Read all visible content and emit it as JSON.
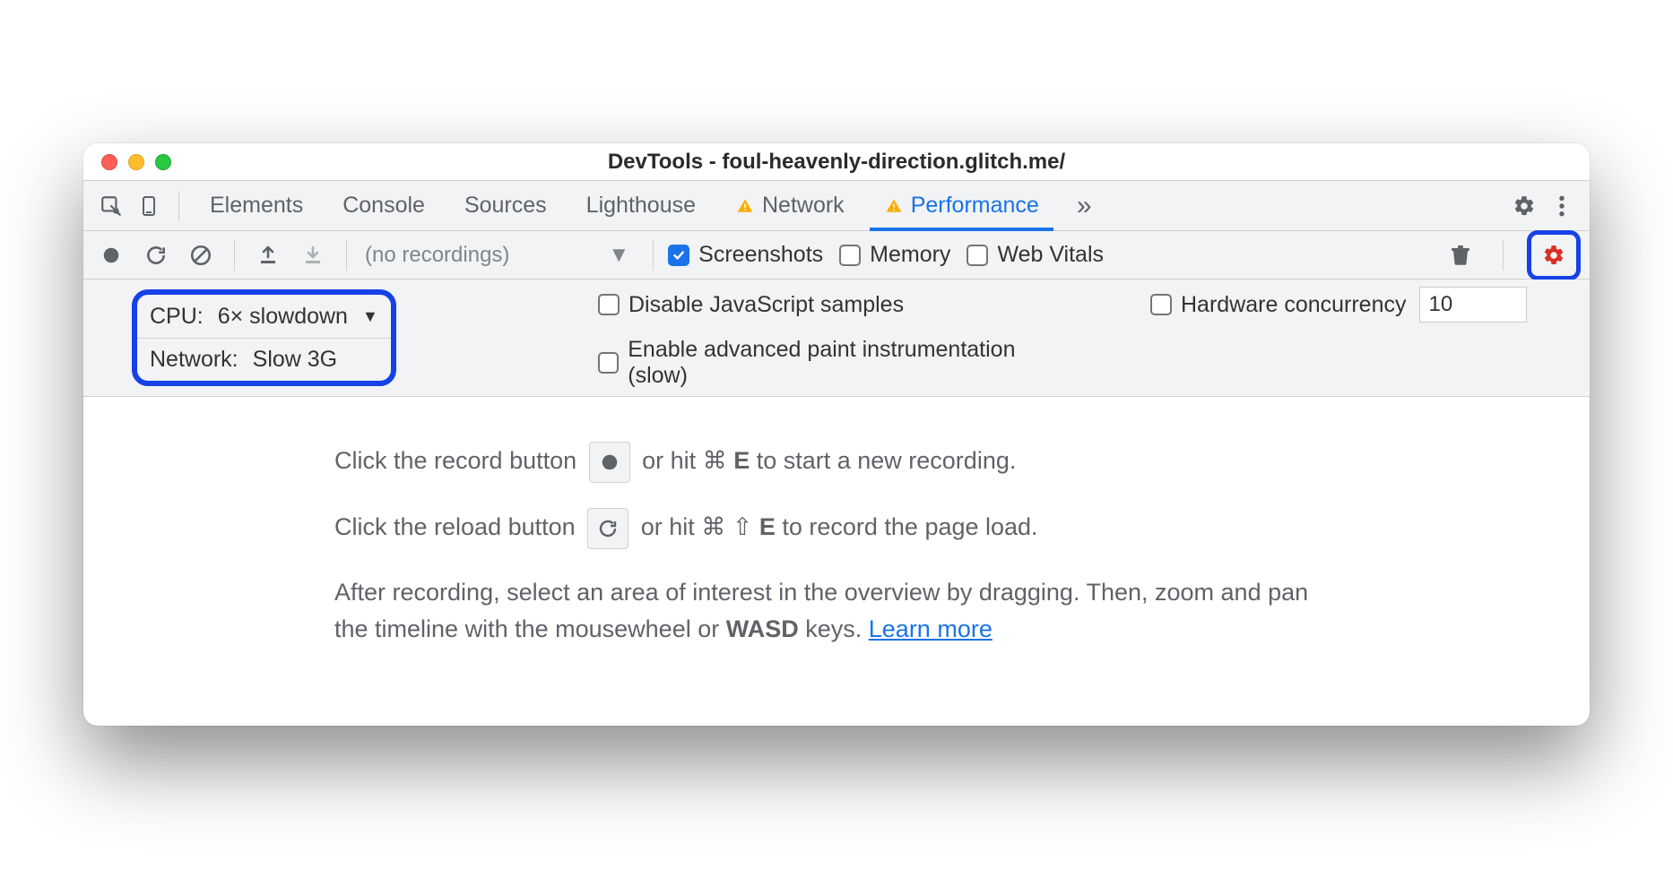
{
  "window": {
    "title": "DevTools - foul-heavenly-direction.glitch.me/"
  },
  "tabs": {
    "items": [
      "Elements",
      "Console",
      "Sources",
      "Lighthouse",
      "Network",
      "Performance"
    ],
    "active": "Performance",
    "network_has_warning": true,
    "performance_has_warning": true
  },
  "toolbar": {
    "recordings_label": "(no recordings)",
    "screenshots": {
      "label": "Screenshots",
      "checked": true
    },
    "memory": {
      "label": "Memory",
      "checked": false
    },
    "webvitals": {
      "label": "Web Vitals",
      "checked": false
    }
  },
  "settings": {
    "disable_js": {
      "label": "Disable JavaScript samples",
      "checked": false
    },
    "paint_instr": {
      "label": "Enable advanced paint instrumentation (slow)",
      "checked": false
    },
    "cpu": {
      "label": "CPU:",
      "value": "6× slowdown"
    },
    "network": {
      "label": "Network:",
      "value": "Slow 3G"
    },
    "hc": {
      "label": "Hardware concurrency",
      "checked": false,
      "value": "10"
    }
  },
  "help": {
    "line1a": "Click the record button ",
    "line1b": " or hit ⌘ ",
    "line1key": "E",
    "line1c": " to start a new recording.",
    "line2a": "Click the reload button ",
    "line2b": " or hit ⌘ ⇧ ",
    "line2key": "E",
    "line2c": " to record the page load.",
    "line3a": "After recording, select an area of interest in the overview by dragging. Then, zoom and pan the timeline with the mousewheel or ",
    "line3wasd": "WASD",
    "line3b": " keys. ",
    "learn": "Learn more"
  }
}
